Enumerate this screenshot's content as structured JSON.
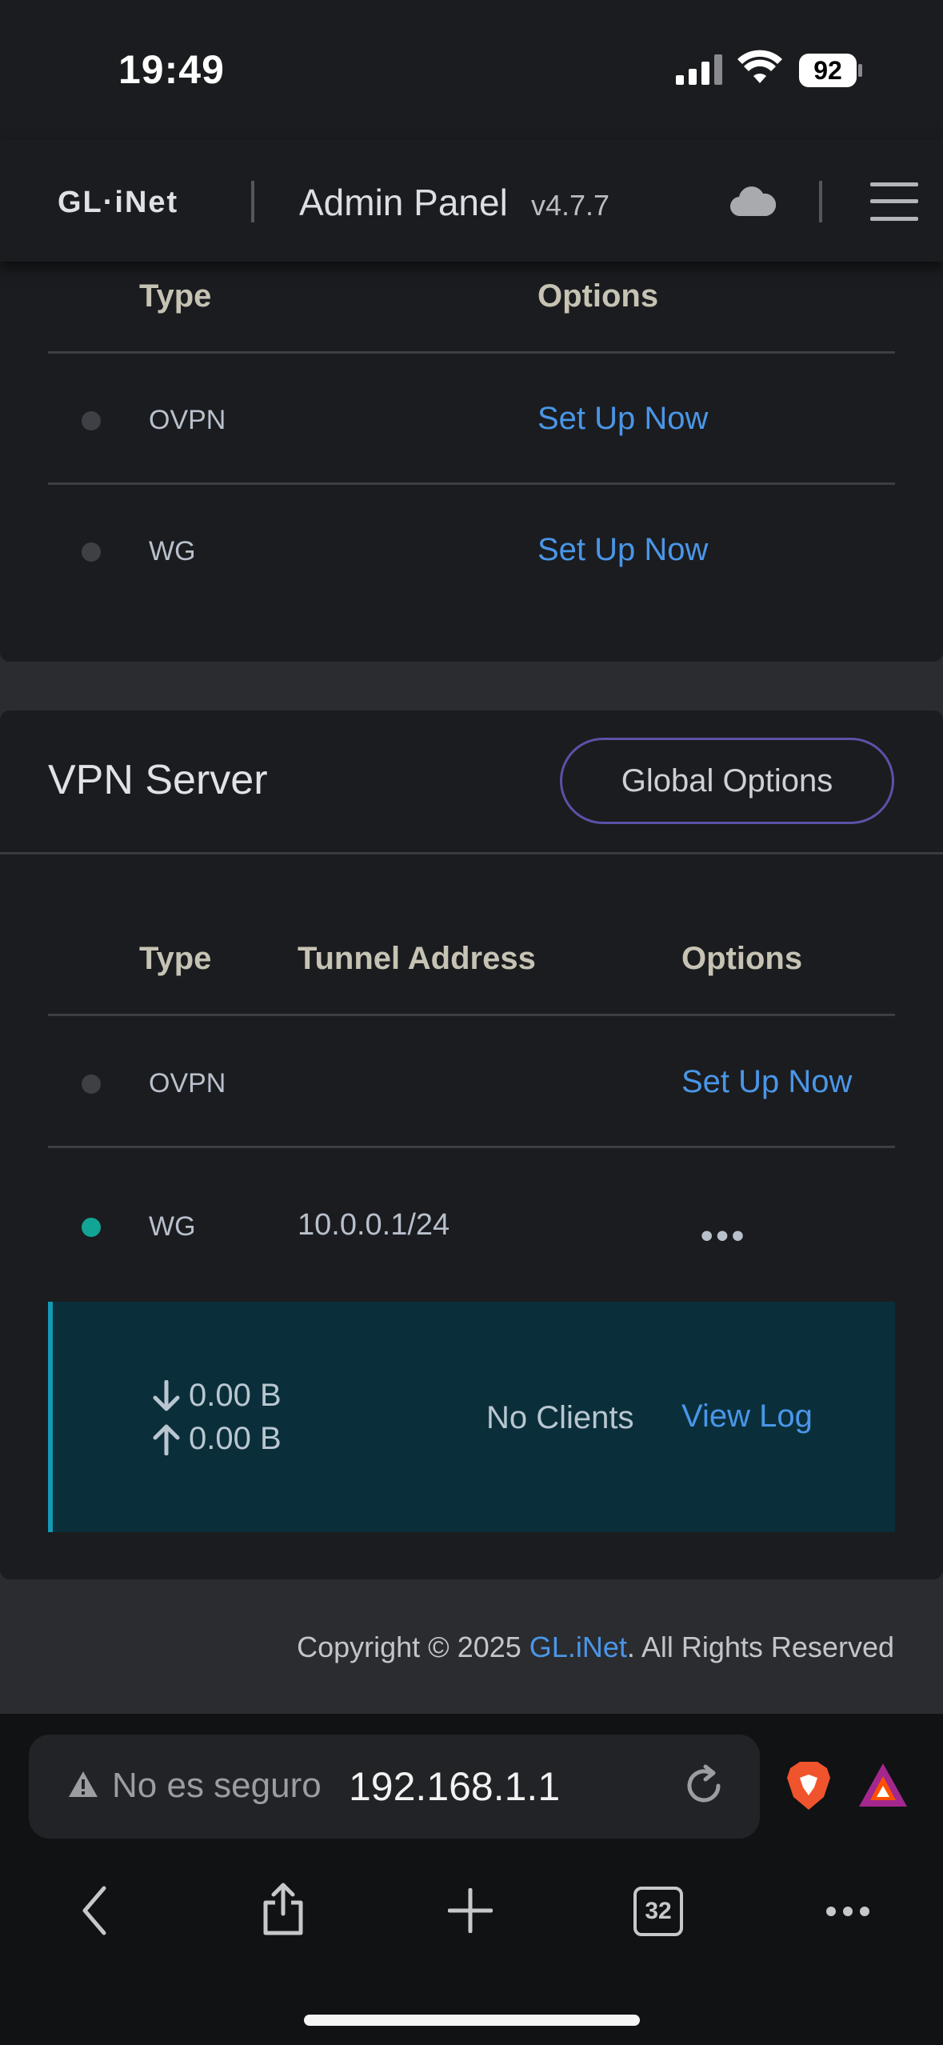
{
  "status": {
    "time": "19:49",
    "battery": "92"
  },
  "header": {
    "logo": "GL·iNet",
    "title": "Admin Panel",
    "version": "v4.7.7",
    "cloud_icon": "cloud-icon",
    "menu_icon": "hamburger-menu-icon"
  },
  "client_table": {
    "headers": {
      "type": "Type",
      "options": "Options"
    },
    "rows": [
      {
        "type": "OVPN",
        "action": "Set Up Now"
      },
      {
        "type": "WG",
        "action": "Set Up Now"
      }
    ]
  },
  "vpn_server": {
    "title": "VPN Server",
    "global_options": "Global Options",
    "headers": {
      "type": "Type",
      "tunnel": "Tunnel Address",
      "options": "Options"
    },
    "rows": [
      {
        "type": "OVPN",
        "tunnel": "",
        "action": "Set Up Now",
        "status": "off"
      },
      {
        "type": "WG",
        "tunnel": "10.0.0.1/24",
        "action": "•••",
        "status": "on"
      }
    ],
    "detail": {
      "download": "0.00 B",
      "upload": "0.00 B",
      "clients": "No Clients",
      "view_log": "View Log"
    }
  },
  "footer": {
    "prefix": "Copyright © 2025 ",
    "brand": "GL.iNet",
    "suffix": ". All Rights Reserved"
  },
  "browser": {
    "warning": "No es seguro",
    "url": "192.168.1.1",
    "tabs": "32"
  },
  "colors": {
    "accent": "#4a96e8",
    "online": "#12a495",
    "button_border": "#5a52a8",
    "detail_bg": "#0a2f3b"
  }
}
